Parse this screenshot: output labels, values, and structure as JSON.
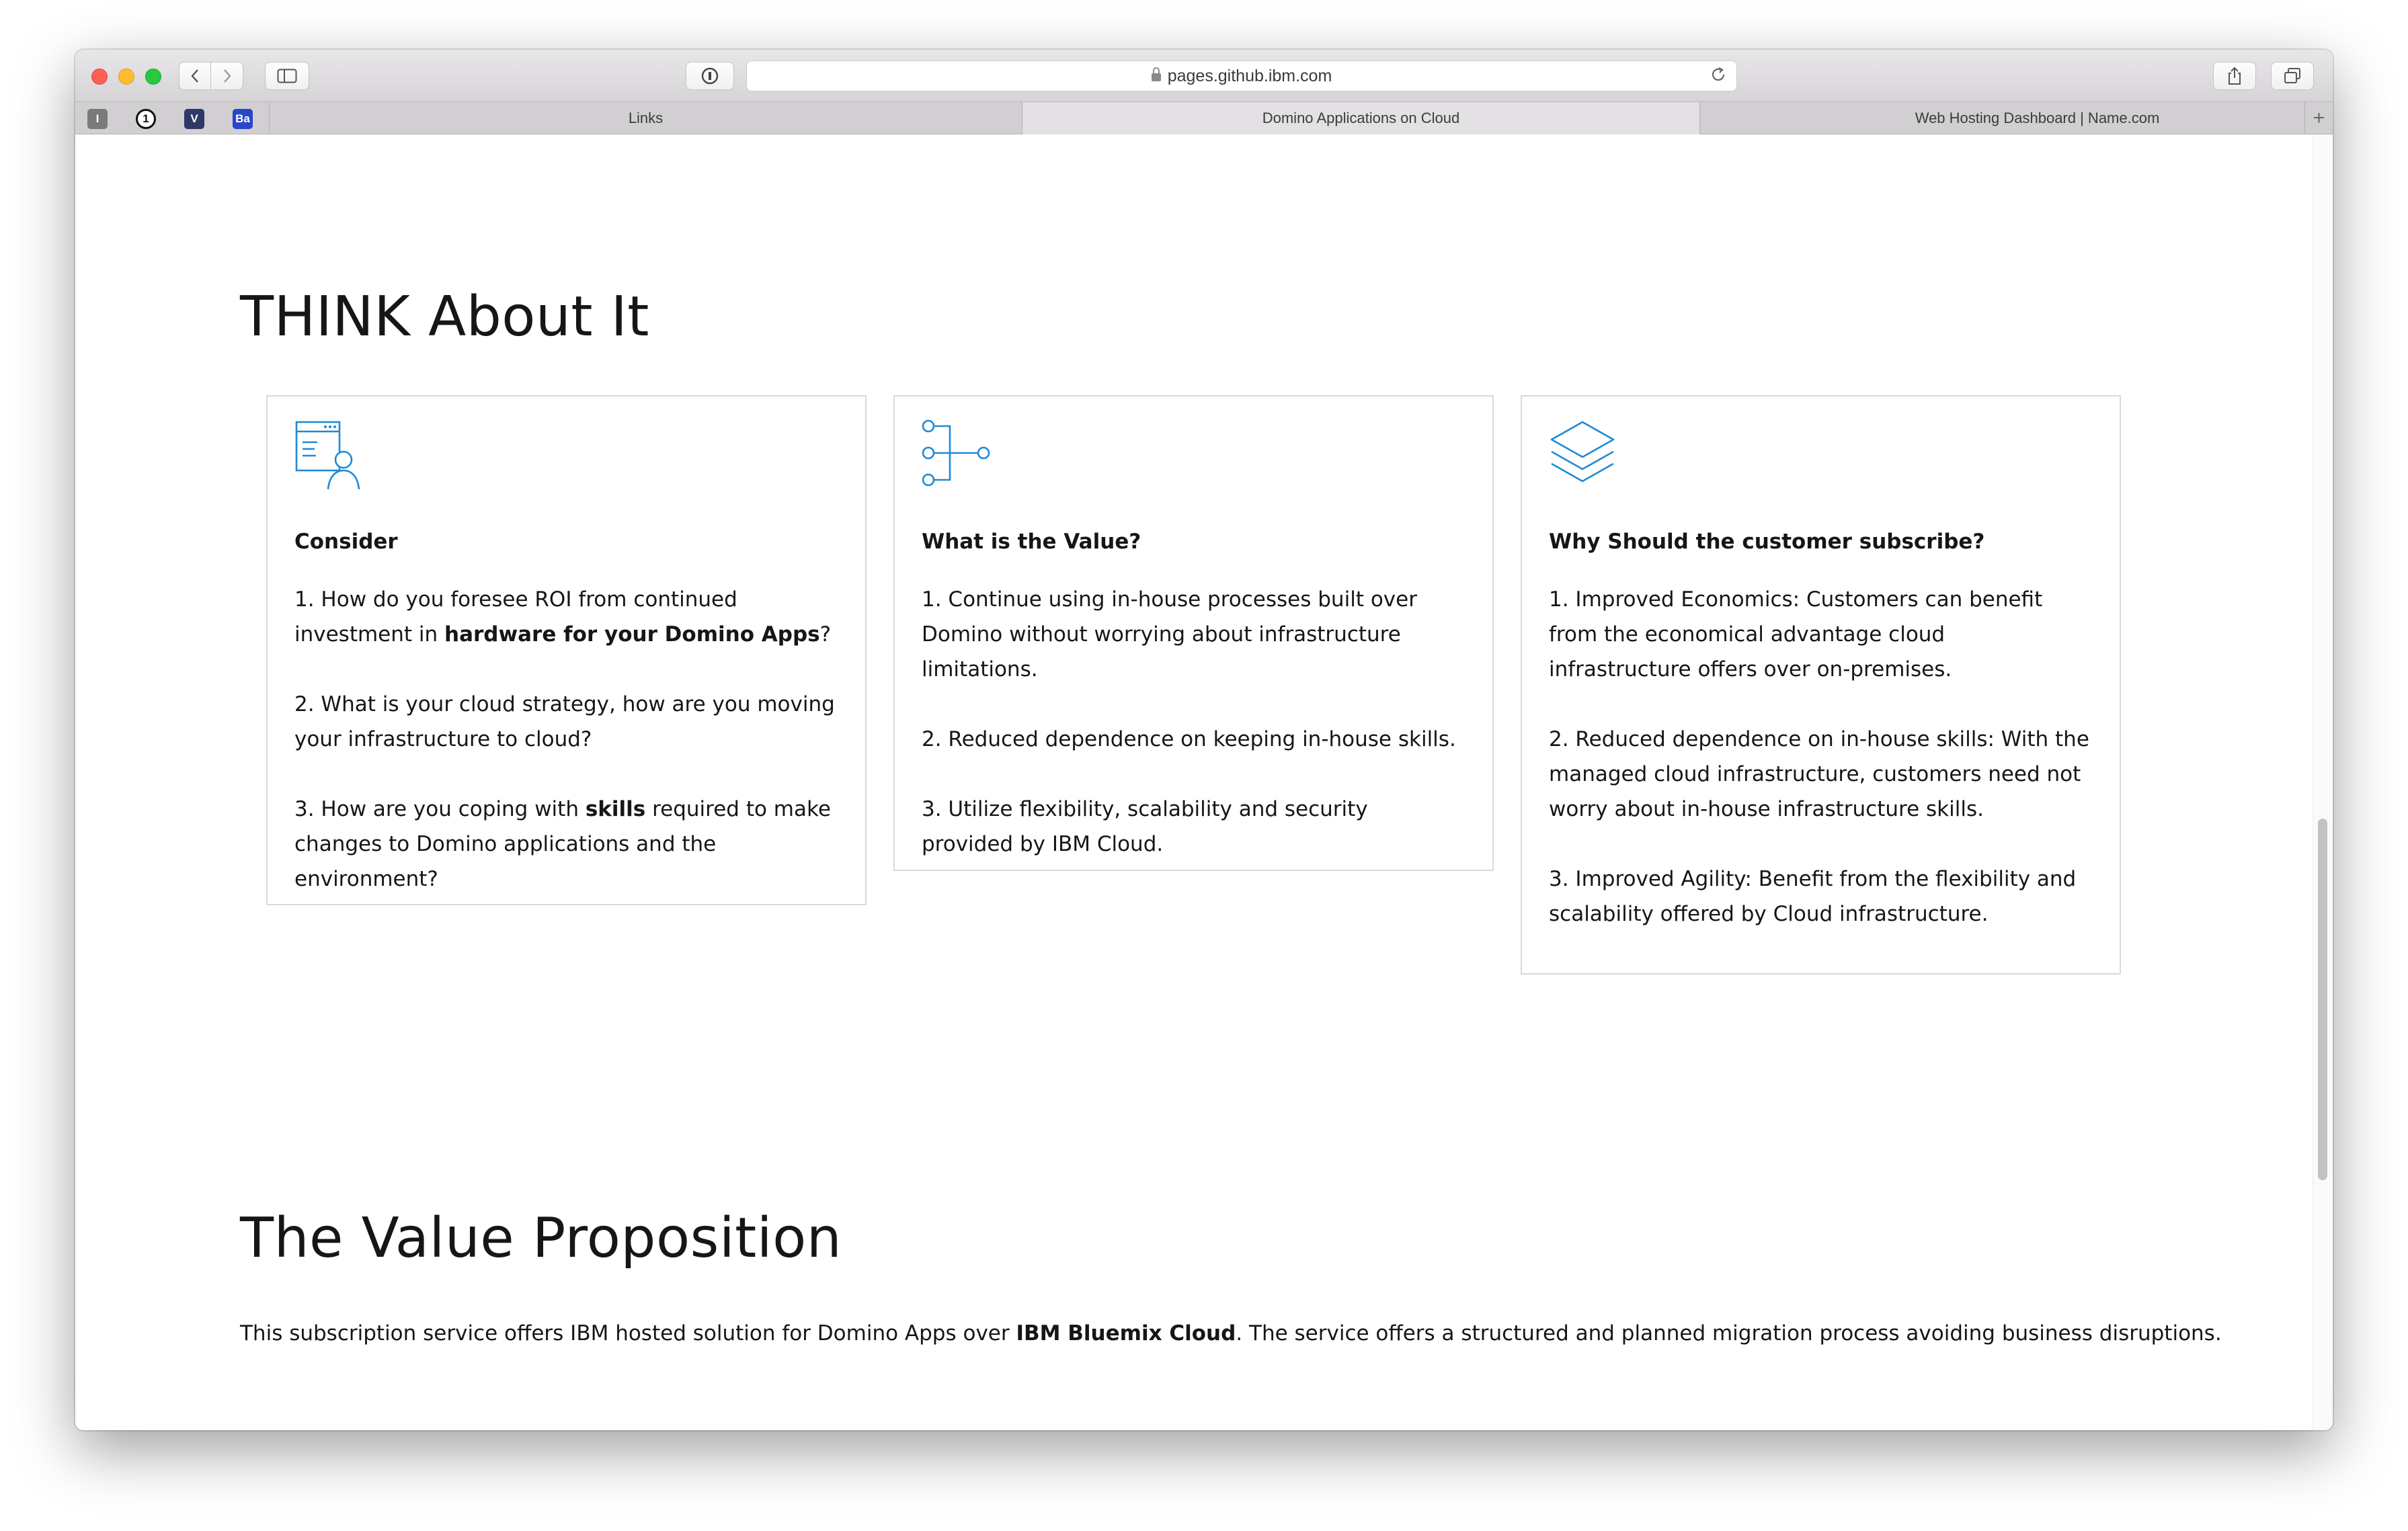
{
  "browser": {
    "url": "pages.github.ibm.com",
    "pinned_tabs": [
      "I",
      "1",
      "V",
      "Ba"
    ],
    "tabs": [
      {
        "label": "Links"
      },
      {
        "label": "Domino Applications on Cloud"
      },
      {
        "label": "Web Hosting Dashboard | Name.com"
      }
    ],
    "new_tab_label": "+"
  },
  "page": {
    "think_heading": "THINK About It",
    "cards": [
      {
        "icon": "document-person-icon",
        "title": "Consider",
        "items": [
          {
            "pre": "1. How do you foresee ROI from continued investment in ",
            "bold": "hardware for your Domino Apps",
            "post": "?"
          },
          {
            "pre": "2. What is your cloud strategy, how are you moving your infrastructure to cloud?",
            "bold": "",
            "post": ""
          },
          {
            "pre": "3. How are you coping with ",
            "bold": "skills",
            "post": " required to make changes to Domino applications and the environment?"
          }
        ]
      },
      {
        "icon": "flow-connection-icon",
        "title": "What is the Value?",
        "items": [
          {
            "pre": "1. Continue using in-house processes built over Domino without worrying about infrastructure limitations.",
            "bold": "",
            "post": ""
          },
          {
            "pre": "2. Reduced dependence on keeping in-house skills.",
            "bold": "",
            "post": ""
          },
          {
            "pre": "3. Utilize flexibility, scalability and security provided by IBM Cloud.",
            "bold": "",
            "post": ""
          }
        ]
      },
      {
        "icon": "layers-stack-icon",
        "title": "Why Should the customer subscribe?",
        "items": [
          {
            "pre": "1. Improved Economics: Customers can benefit from the economical advantage cloud infrastructure offers over on-premises.",
            "bold": "",
            "post": ""
          },
          {
            "pre": "2. Reduced dependence on in-house skills: With the managed cloud infrastructure, customers need not worry about in-house infrastructure skills.",
            "bold": "",
            "post": ""
          },
          {
            "pre": "3. Improved Agility: Benefit from the flexibility and scalability offered by Cloud infrastructure.",
            "bold": "",
            "post": ""
          }
        ]
      }
    ],
    "value_heading": "The Value Proposition",
    "value_paragraph": {
      "pre": "This subscription service offers IBM hosted solution for Domino Apps over ",
      "bold": "IBM Bluemix Cloud",
      "post": ". The service offers a structured and planned migration process avoiding business disruptions."
    }
  },
  "colors": {
    "icon_blue": "#1e8ad6",
    "card_border": "#d9d9d9",
    "text": "#161616"
  }
}
